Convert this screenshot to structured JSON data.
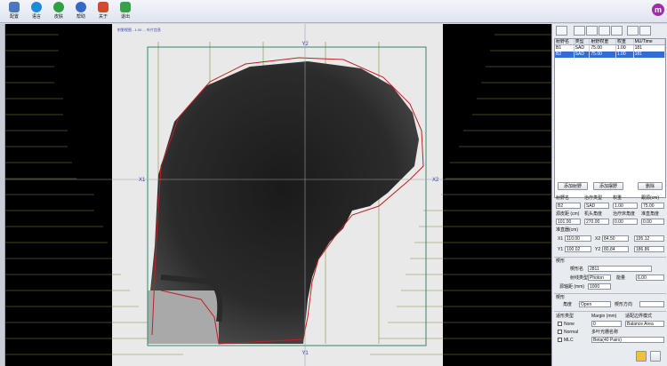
{
  "toolbar": {
    "buttons": [
      {
        "label": "配置",
        "icon": "config-icon",
        "color": "#4a78c0"
      },
      {
        "label": "语言",
        "icon": "globe-icon",
        "color": "#1f8ad8"
      },
      {
        "label": "皮肤",
        "icon": "skin-icon",
        "color": "#2ea043"
      },
      {
        "label": "帮助",
        "icon": "help-icon",
        "color": "#3768c8"
      },
      {
        "label": "关于",
        "icon": "about-icon",
        "color": "#d04a2f"
      },
      {
        "label": "退出",
        "icon": "exit-icon",
        "color": "#3aa04a"
      }
    ],
    "logo": "m"
  },
  "viewer": {
    "header_text": "射野视图 - 1.00 ... 叶片信息",
    "label_top": "Y2",
    "label_right": "X2",
    "label_left": "X1",
    "label_bottom": "Y1"
  },
  "panel": {
    "grid": {
      "headers": [
        "射野名",
        "类型",
        "射野权重",
        "权重",
        "MU/Time"
      ],
      "rows": [
        {
          "name": "B1",
          "type": "SAD",
          "weight_pct": "75.00",
          "weight": "1.00",
          "mu": "181"
        },
        {
          "name": "B2",
          "type": "SAD",
          "weight_pct": "75.00",
          "weight": "1.00",
          "mu": "181"
        }
      ],
      "selected_index": 1
    },
    "buttons": {
      "add_beam": "添加射野",
      "add_setup_beam": "添加摆野",
      "delete": "删除"
    },
    "labels": {
      "beam_name": "射野名",
      "treat_type": "治疗类型",
      "weight": "权重",
      "field_size": "跟源(cm)",
      "ssd": "源皮距 (cm)",
      "gantry": "机头角度",
      "couch": "治疗床角度",
      "collimator": "准直角度",
      "jaw": "准直器(cm)",
      "x1": "X1",
      "x2": "X2",
      "y1": "Y1",
      "y2": "Y2",
      "wedge_section": "楔形",
      "wedge_name": "楔形名",
      "ray_type": "射线类型",
      "energy": "能量",
      "margin": "源轴距 (mm)",
      "shape_section": "楔形",
      "angle": "角度",
      "direction": "楔形方向",
      "fit_type": "适形类型",
      "margin_mm": "Margin (mm)",
      "fit_mode": "适配边界模式",
      "none": "None",
      "normal": "Normal",
      "mlc": "MLC",
      "mlc_name": "多叶光栅名称"
    },
    "values": {
      "beam_name": "B2",
      "treat_type": "SAD",
      "weight": "1.00",
      "field_size": "75.00",
      "ssd": "101.00",
      "gantry": "270.00",
      "couch": "0.00",
      "collimator": "0.00",
      "x1": "110.00",
      "x2": "84.50",
      "y2_top": "195.12",
      "y1": "100.02",
      "y2": "80.84",
      "y_last": "186.86",
      "wedge_name": "2811",
      "ray_type": "Photon",
      "energy": "6.00",
      "margin": "1000",
      "angle": "Open",
      "margin_mm": "0",
      "fit_mode": "Balance Area",
      "mlc_name": "Beta(40 Pairs)"
    }
  }
}
